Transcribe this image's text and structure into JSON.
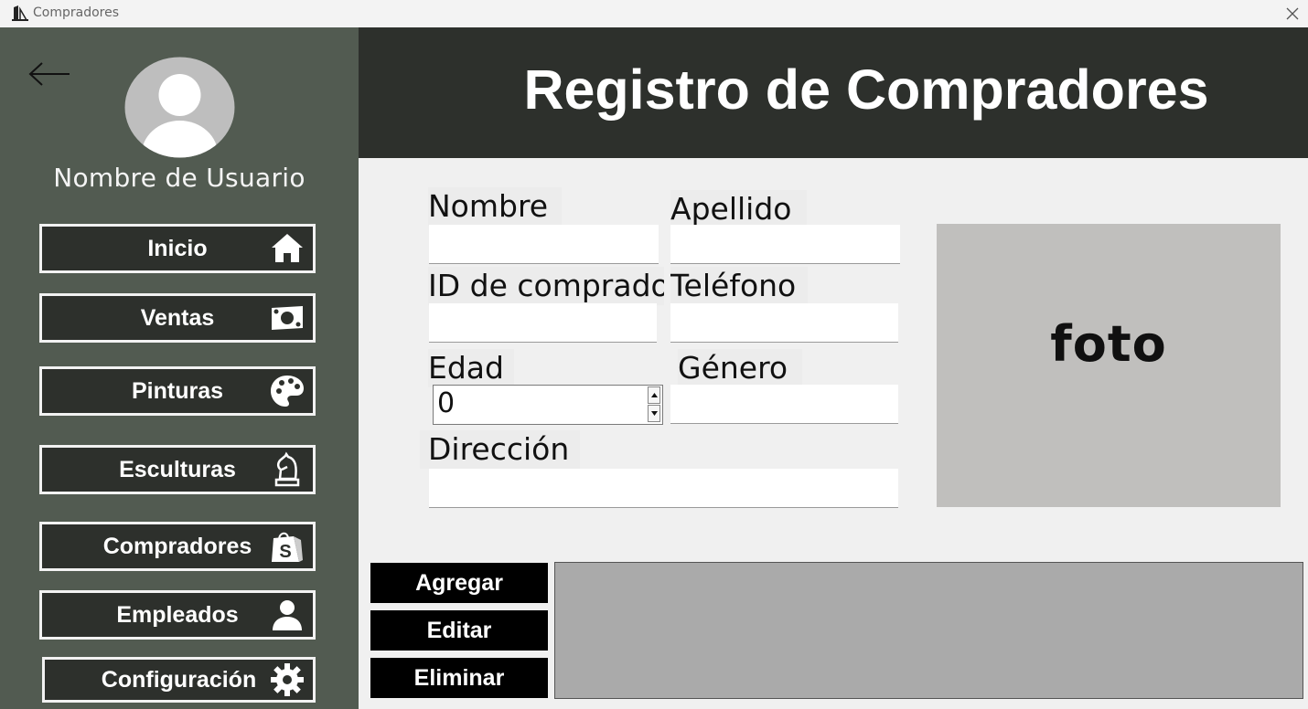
{
  "window": {
    "title": "Compradores",
    "close_glyph": "×"
  },
  "sidebar": {
    "username": "Nombre de Usuario",
    "items": [
      {
        "label": "Inicio",
        "icon": "home-icon"
      },
      {
        "label": "Ventas",
        "icon": "money-icon"
      },
      {
        "label": "Pinturas",
        "icon": "palette-icon"
      },
      {
        "label": "Esculturas",
        "icon": "chess-knight-icon"
      },
      {
        "label": "Compradores",
        "icon": "shopping-bag-icon"
      },
      {
        "label": "Empleados",
        "icon": "user-icon"
      },
      {
        "label": "Configuración",
        "icon": "gear-icon"
      }
    ]
  },
  "header": {
    "title": "Registro de Compradores"
  },
  "form": {
    "nombre_label": "Nombre",
    "apellido_label": "Apellido",
    "id_label": "ID de comprado",
    "telefono_label": "Teléfono",
    "edad_label": "Edad",
    "edad_value": "0",
    "genero_label": "Género",
    "direccion_label": "Dirección",
    "nombre_value": "",
    "apellido_value": "",
    "id_value": "",
    "telefono_value": "",
    "genero_value": "",
    "direccion_value": ""
  },
  "photo": {
    "label": "foto"
  },
  "actions": {
    "add": "Agregar",
    "edit": "Editar",
    "delete": "Eliminar"
  },
  "colors": {
    "sidebar": "#525b51",
    "header": "#2d302c",
    "button": "#2d302c",
    "photo": "#c0bfbd",
    "grid": "#aaaaaa"
  }
}
